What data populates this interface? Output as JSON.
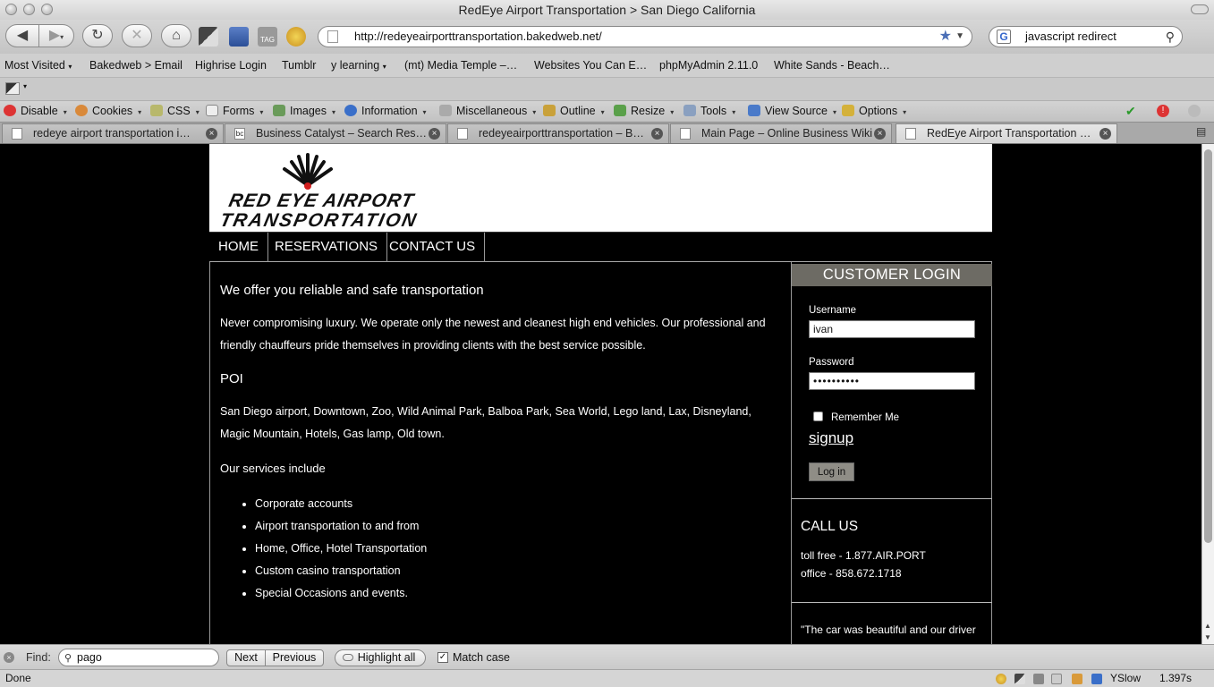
{
  "window": {
    "title": "RedEye Airport Transportation > San Diego California"
  },
  "toolbar": {
    "back_icon": "back-arrow-icon",
    "forward_icon": "forward-arrow-icon",
    "url": "http://redeyeairporttransportation.bakedweb.net/",
    "search_value": "javascript redirect",
    "search_engine_glyph": "G"
  },
  "bookmarks": [
    "Most Visited",
    "Bakedweb > Email",
    "Highrise Login",
    "Tumblr",
    "y learning",
    "(mt) Media Temple –…",
    "Websites You Can E…",
    "phpMyAdmin 2.11.0",
    "White Sands - Beach…"
  ],
  "devbar": {
    "items": [
      "Disable",
      "Cookies",
      "CSS",
      "Forms",
      "Images",
      "Information",
      "Miscellaneous",
      "Outline",
      "Resize",
      "Tools",
      "View Source",
      "Options"
    ]
  },
  "tabs": [
    {
      "label": "redeye airport transportation i…",
      "fav": ""
    },
    {
      "label": "Business Catalyst – Search Res…",
      "fav": "bc"
    },
    {
      "label": "redeyeairporttransportation – B…",
      "fav": ""
    },
    {
      "label": "Main Page – Online Business Wiki",
      "fav": ""
    },
    {
      "label": "RedEye Airport Transportation …",
      "fav": ""
    }
  ],
  "site": {
    "logo_line1": "RED EYE AIRPORT",
    "logo_line2": "TRANSPORTATION",
    "nav": [
      "HOME",
      "RESERVATIONS",
      "CONTACT US"
    ],
    "heading1": "We offer you reliable and safe transportation",
    "intro": "Never compromising luxury. We operate only the newest and cleanest high end vehicles. Our professional and friendly chauffeurs pride themselves in providing clients with the best service possible.",
    "heading2": "POI",
    "poi_text": "San Diego airport, Downtown, Zoo, Wild Animal Park, Balboa Park, Sea World, Lego land, Lax, Disneyland, Magic Mountain, Hotels, Gas lamp, Old town.",
    "heading3": "Our services include",
    "services": [
      "Corporate accounts",
      "Airport transportation to and from",
      "Home, Office, Hotel Transportation",
      "Custom casino transportation",
      "Special Occasions and events."
    ],
    "login": {
      "title": "CUSTOMER LOGIN",
      "username_label": "Username",
      "username_value": "ivan",
      "password_label": "Password",
      "password_value": "••••••••••",
      "remember_label": "Remember Me",
      "signup": "signup",
      "button": "Log in"
    },
    "call": {
      "title": "CALL US",
      "tollfree": "toll free - 1.877.AIR.PORT",
      "office": "office - 858.672.1718"
    },
    "quote": "\"The car was beautiful and our driver"
  },
  "findbar": {
    "label": "Find:",
    "value": "pago",
    "next": "Next",
    "previous": "Previous",
    "highlight": "Highlight all",
    "match_case": "Match case"
  },
  "status": {
    "text": "Done",
    "yslow": "YSlow",
    "time": "1.397s"
  }
}
